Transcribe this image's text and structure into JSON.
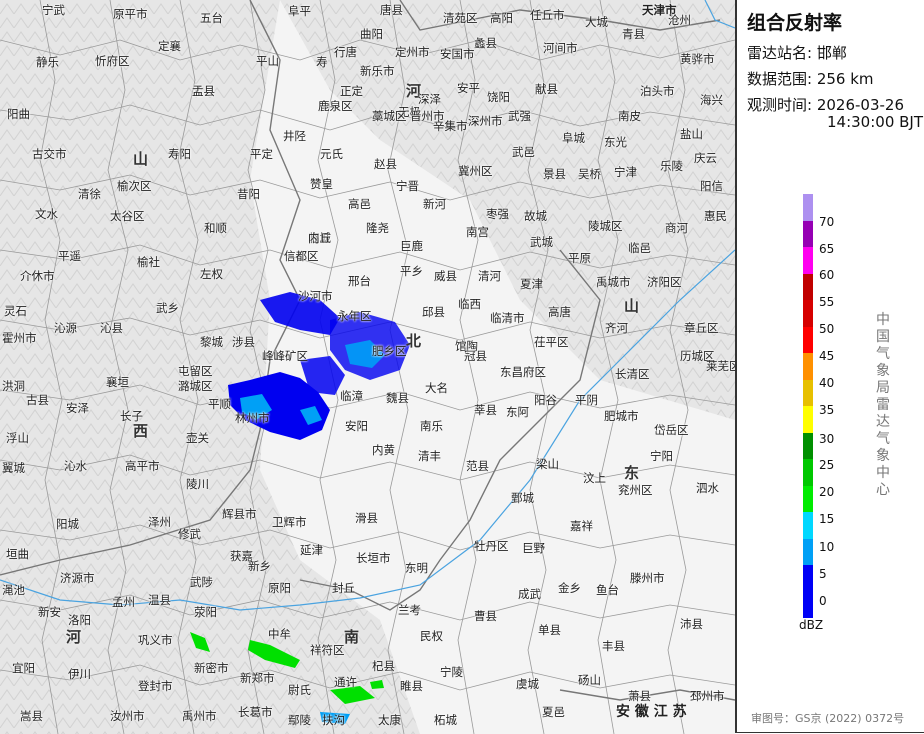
{
  "panel": {
    "title": "组合反射率",
    "station_label": "雷达站名:",
    "station_value": "邯郸",
    "range_label": "数据范围:",
    "range_value": "256 km",
    "time_label": "观测时间:",
    "time_date": "2026-03-26",
    "time_clock": "14:30:00 BJT",
    "vendor": "中国气象局雷达气象中心",
    "review_no": "审图号：GS京 (2022) 0372号"
  },
  "legend": {
    "unit": "dBZ",
    "ticks": [
      "70",
      "65",
      "60",
      "55",
      "50",
      "45",
      "40",
      "35",
      "30",
      "25",
      "20",
      "15",
      "10",
      "5",
      "0"
    ],
    "colors": [
      "#ad90f0",
      "#9600b4",
      "#ff00f0",
      "#c00000",
      "#d60000",
      "#ff0000",
      "#ff9000",
      "#e7c000",
      "#ffff00",
      "#009000",
      "#00c800",
      "#00ec00",
      "#00d8ff",
      "#00a0f6",
      "#0000f6",
      "#0000f6"
    ]
  },
  "map": {
    "provinces": [
      {
        "text": "山",
        "group": "a"
      },
      {
        "text": "西",
        "group": "a"
      },
      {
        "text": "河",
        "group": "b"
      },
      {
        "text": "北",
        "group": "b"
      },
      {
        "text": "山",
        "group": "c"
      },
      {
        "text": "东",
        "group": "c"
      },
      {
        "text": "河",
        "group": "d"
      },
      {
        "text": "南",
        "group": "d"
      },
      {
        "text": "安 徽 江 苏",
        "group": "e"
      },
      {
        "text": "天津市",
        "group": "f"
      }
    ],
    "cities": [
      "宁武",
      "原平市",
      "五台",
      "阜平",
      "唐县",
      "清苑区",
      "高阳",
      "任丘市",
      "大城",
      "青县",
      "黄骅市",
      "沧州",
      "静乐",
      "忻府区",
      "定襄",
      "平山",
      "寿",
      "行唐",
      "曲阳",
      "定州市",
      "安国市",
      "蠡县",
      "河间市",
      "献县",
      "孟县",
      "新乐市",
      "正定",
      "无极",
      "深泽",
      "安平",
      "饶阳",
      "献县",
      "泊头市",
      "海兴",
      "盂县",
      "鹿泉区",
      "藁城区",
      "晋州市",
      "辛集市",
      "深州市",
      "武强",
      "阜城",
      "南皮",
      "盐山",
      "阳曲",
      "井陉",
      "平定",
      "元氏",
      "赵县",
      "宁晋",
      "冀州区",
      "武邑",
      "景县",
      "东光",
      "庆云",
      "古交市",
      "寿阳",
      "昔阳",
      "赞皇",
      "高邑",
      "新河",
      "枣强",
      "故城",
      "吴桥",
      "宁津",
      "乐陵",
      "阳信",
      "清徐",
      "榆次区",
      "和顺",
      "临城",
      "隆尧",
      "巨鹿",
      "南宫",
      "武城",
      "陵城区",
      "临邑",
      "商河",
      "惠民",
      "文水",
      "太谷区",
      "左权",
      "内丘",
      "平乡",
      "威县",
      "清河",
      "夏津",
      "平原",
      "禹城市",
      "济阳区",
      "平遥",
      "榆社",
      "邢台",
      "信都区",
      "临西",
      "临清市",
      "高唐",
      "齐河",
      "章丘区",
      "介休市",
      "武乡",
      "沙河市",
      "永年区",
      "邱县",
      "馆陶",
      "茌平区",
      "长清区",
      "历城区",
      "灵石",
      "沁源",
      "沁县",
      "黎城",
      "涉县",
      "峰峰矿区",
      "肥乡区",
      "冠县",
      "东昌府区",
      "莱芜区",
      "霍州市",
      "襄垣",
      "屯留区",
      "潞城区",
      "临漳",
      "魏县",
      "大名",
      "阳谷",
      "平阴",
      "肥城市",
      "洪洞",
      "古县",
      "安泽",
      "长子",
      "壶关",
      "平顺",
      "林州市",
      "安阳",
      "内黄",
      "南乐",
      "莘县",
      "东阿",
      "岱岳区",
      "浮山",
      "沁水",
      "高平市",
      "陵川",
      "辉县市",
      "卫辉市",
      "滑县",
      "清丰",
      "范县",
      "梁山",
      "汶上",
      "宁阳",
      "翼城",
      "阳城",
      "泽州",
      "修武",
      "获嘉",
      "新乡",
      "延津",
      "长垣市",
      "东明",
      "鄄城",
      "嘉祥",
      "兖州区",
      "泗水",
      "垣曲",
      "济源市",
      "孟州",
      "温县",
      "武陟",
      "原阳",
      "封丘",
      "兰考",
      "牡丹区",
      "巨野",
      "金乡",
      "鱼台",
      "滕州市",
      "渑池",
      "新安",
      "洛阳",
      "巩义市",
      "荥阳",
      "中牟",
      "祥符区",
      "民权",
      "曹县",
      "成武",
      "单县",
      "沛县",
      "宜阳",
      "伊川",
      "登封市",
      "新密市",
      "新郑市",
      "尉氏",
      "通许",
      "杞县",
      "睢县",
      "宁陵",
      "虞城",
      "砀山",
      "丰县",
      "嵩县",
      "汝州市",
      "禹州市",
      "长葛市",
      "鄢陵",
      "扶沟",
      "太康",
      "柘城",
      "夏邑",
      "萧县",
      "邳州市"
    ]
  }
}
